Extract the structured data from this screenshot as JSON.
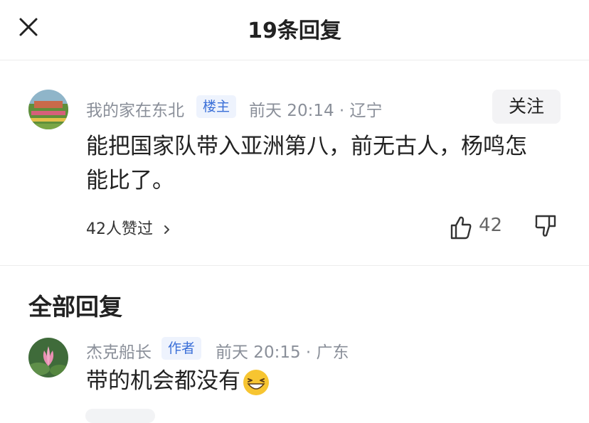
{
  "header": {
    "title": "19条回复"
  },
  "main_comment": {
    "username": "我的家在东北",
    "tag": "楼主",
    "meta": "前天 20:14 · 辽宁",
    "follow_label": "关注",
    "content_line1": "能把国家队带入亚洲第八，前无古人，杨鸣怎",
    "content_line2": "能比了。",
    "likes_text": "42人赞过",
    "like_count": "42"
  },
  "section": {
    "title": "全部回复"
  },
  "reply": {
    "username": "杰克船长",
    "tag": "作者",
    "meta": "前天 20:15 · 广东",
    "content": "带的机会都没有",
    "emoji": "laughing-emoji"
  }
}
